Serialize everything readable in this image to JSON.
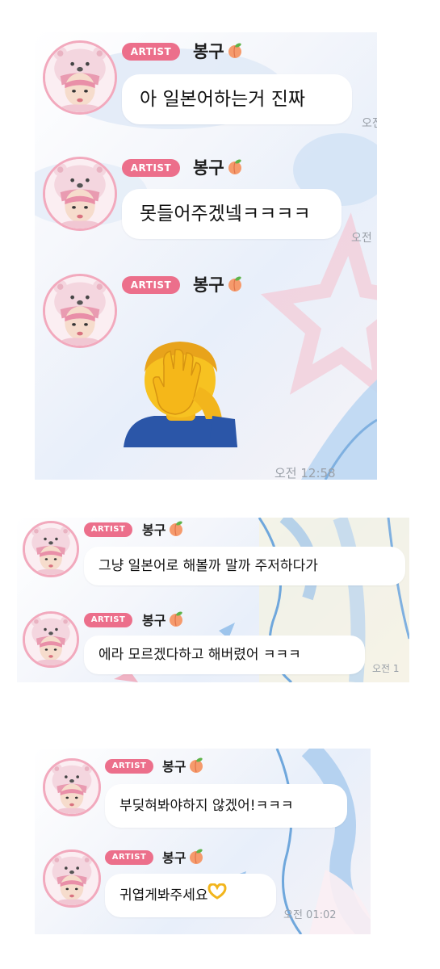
{
  "artist_badge": "ARTIST",
  "sender_name": "봉구",
  "icons": {
    "peach": "peach-emoji-icon",
    "facepalm": "facepalm-emoji-icon",
    "heart_hands": "heart-hands-emoji-icon",
    "avatar": "bear-hat-avatar"
  },
  "colors": {
    "badge": "#ec6f8b",
    "avatar_ring": "#f2a9bd",
    "bubble": "#ffffff",
    "time": "#9aa0a8"
  },
  "panels": [
    {
      "messages": [
        {
          "text": "아 일본어하는거 진짜",
          "time": "오전"
        },
        {
          "text": "못들어주겠넼ㅋㅋㅋㅋ",
          "time": "오전"
        },
        {
          "sticker": "facepalm-emoji-icon",
          "time": "오전 12:58"
        }
      ]
    },
    {
      "messages": [
        {
          "text": "그냥 일본어로 해볼까 말까 주저하다가"
        },
        {
          "text": "에라 모르겠다하고 해버렸어 ㅋㅋㅋ",
          "time": "오전 1"
        }
      ]
    },
    {
      "messages": [
        {
          "text": "부딪혀봐야하지 않겠어!ㅋㅋㅋ"
        },
        {
          "text": "귀엽게봐주세요",
          "time": "오전 01:02"
        }
      ]
    }
  ]
}
